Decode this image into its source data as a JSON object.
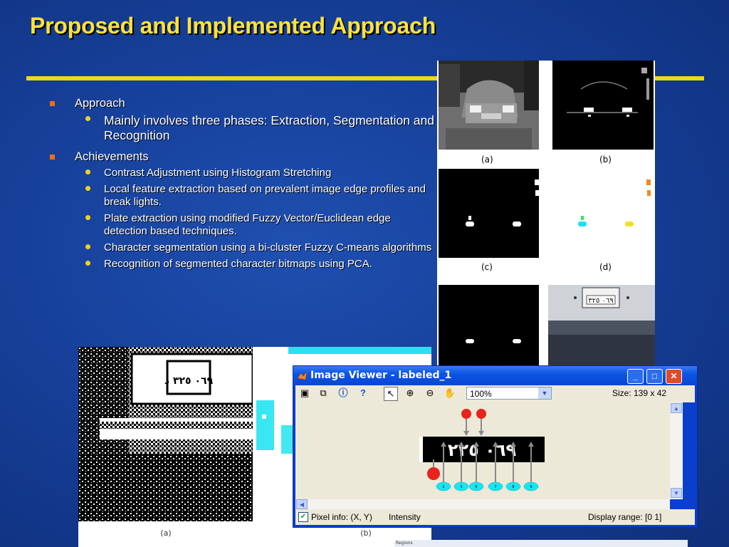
{
  "slide": {
    "title": "Proposed and Implemented Approach"
  },
  "bullets": {
    "approach": {
      "label": "Approach",
      "sub": [
        "Mainly involves three phases: Extraction, Segmentation and Recognition"
      ]
    },
    "achievements": {
      "label": "Achievements",
      "sub": [
        "Contrast Adjustment using Histogram Stretching",
        "Local feature extraction based on prevalent image edge profiles and break lights.",
        "Plate extraction using modified Fuzzy Vector/Euclidean edge detection based techniques.",
        "Character segmentation using a bi-cluster Fuzzy C-means algorithms",
        "Recognition of segmented character bitmaps using PCA."
      ]
    }
  },
  "figure_panel": {
    "captions": [
      "(a)",
      "(b)",
      "(c)",
      "(d)"
    ]
  },
  "binarized_figure": {
    "captions": [
      "(a)",
      "(b)"
    ],
    "plate_text": "٠٦٩ ٣٢٥ د",
    "footer_label": "Regions"
  },
  "image_viewer": {
    "title": "Image Viewer - labeled_1",
    "zoom": "100%",
    "size_label": "Size: 139 x 42",
    "plate_text": "٠٦٩ ٢٢٥",
    "pixel_info_label": "Pixel info: (X, Y)",
    "pixel_info_value": "Intensity",
    "display_range": "Display range: [0  1]",
    "region_labels": [
      "2",
      "3",
      "5",
      "7",
      "8",
      "9"
    ],
    "colors": {
      "title_bar": "#0a55e4",
      "close_button": "#e04a2a",
      "marker_red": "#e8221c",
      "marker_cyan": "#19e4f0"
    }
  }
}
